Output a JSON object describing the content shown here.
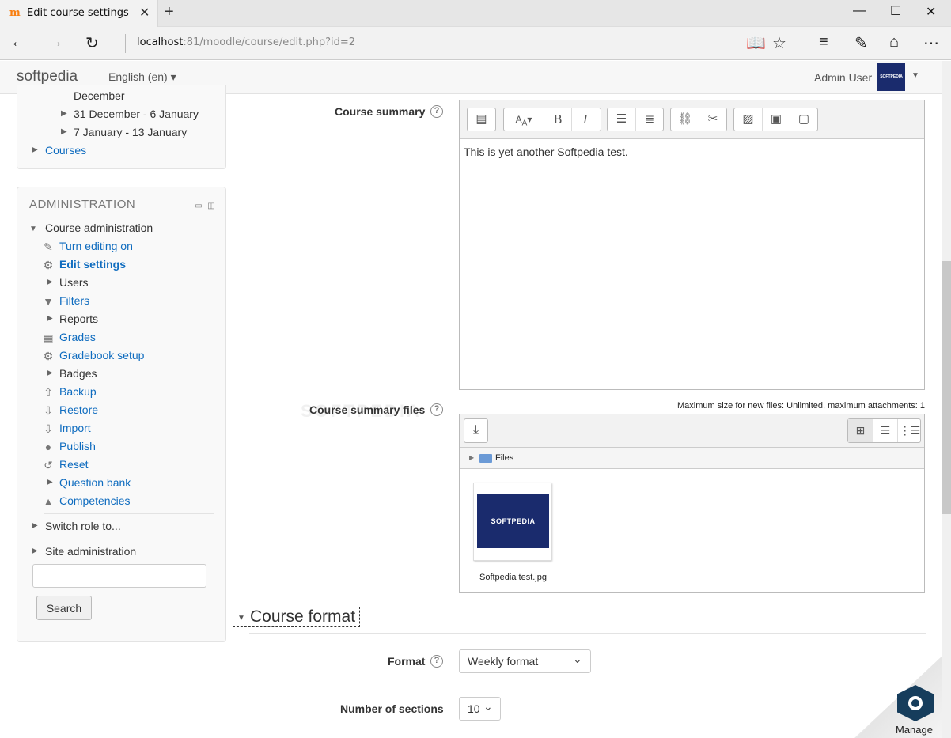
{
  "browser": {
    "tab_title": "Edit course settings",
    "tab_close": "✕",
    "new_tab": "+",
    "url_host": "localhost",
    "url_path": ":81/moodle/course/edit.php?id=2"
  },
  "header": {
    "brand": "softpedia",
    "language": "English (en) ▾",
    "user": "Admin User",
    "avatar_text": "SOFTPEDIA"
  },
  "nav_block": {
    "items": [
      "December",
      "31 December - 6 January",
      "7 January - 13 January",
      "Courses"
    ]
  },
  "admin_block": {
    "title": "ADMINISTRATION",
    "course_admin": "Course administration",
    "items": [
      {
        "label": "Turn editing on",
        "icon": "pencil-icon"
      },
      {
        "label": "Edit settings",
        "icon": "gear-icon"
      },
      {
        "label": "Users",
        "icon": "expand-arrow-icon"
      },
      {
        "label": "Filters",
        "icon": "filter-icon"
      },
      {
        "label": "Reports",
        "icon": "expand-arrow-icon"
      },
      {
        "label": "Grades",
        "icon": "table-icon"
      },
      {
        "label": "Gradebook setup",
        "icon": "gear-icon"
      },
      {
        "label": "Badges",
        "icon": "expand-arrow-icon"
      },
      {
        "label": "Backup",
        "icon": "upload-icon"
      },
      {
        "label": "Restore",
        "icon": "download-icon"
      },
      {
        "label": "Import",
        "icon": "download-icon"
      },
      {
        "label": "Publish",
        "icon": "globe-icon"
      },
      {
        "label": "Reset",
        "icon": "reset-icon"
      },
      {
        "label": "Question bank",
        "icon": "expand-arrow-icon"
      },
      {
        "label": "Competencies",
        "icon": "competencies-icon"
      }
    ],
    "switch_role": "Switch role to...",
    "site_admin": "Site administration",
    "search_button": "Search"
  },
  "form": {
    "course_summary_label": "Course summary",
    "summary_text": "This is yet another Softpedia test.",
    "summary_files_label": "Course summary files",
    "max_size": "Maximum size for new files: Unlimited, maximum attachments: 1",
    "files_path": "Files",
    "file_name": "Softpedia test.jpg",
    "thumb_text": "SOFTPEDIA",
    "watermark": "SOFTPEDIA",
    "course_format_heading": "Course format",
    "format_label": "Format",
    "format_value": "Weekly format",
    "sections_label": "Number of sections",
    "sections_value": "10"
  },
  "footer": {
    "manage_label": "Manage"
  }
}
